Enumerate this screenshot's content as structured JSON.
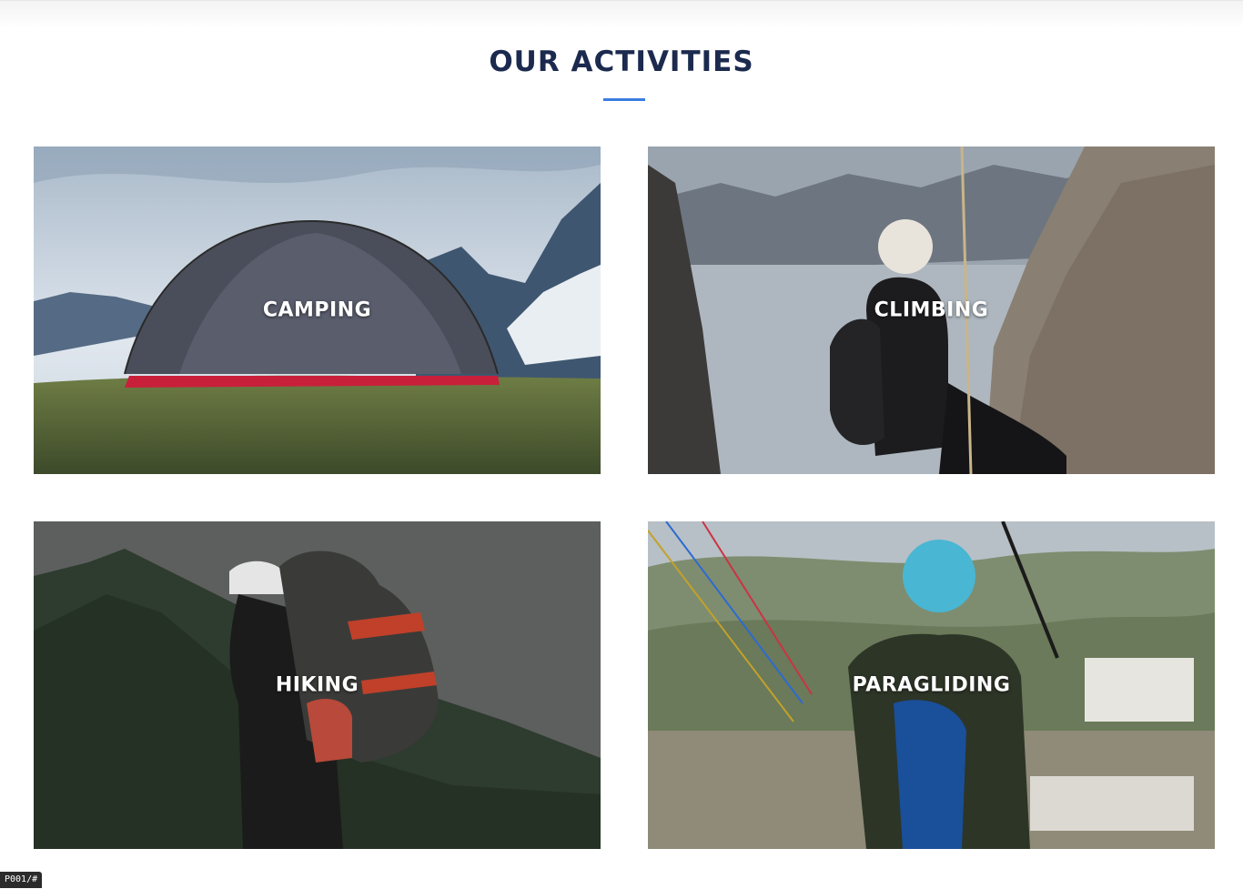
{
  "section": {
    "title": "OUR ACTIVITIES",
    "accent_color": "#3b7de0",
    "title_color": "#1b2a4e"
  },
  "activities": [
    {
      "label": "CAMPING",
      "image": "tent-on-mountain-meadow"
    },
    {
      "label": "CLIMBING",
      "image": "climber-rappelling-cliff"
    },
    {
      "label": "HIKING",
      "image": "hiker-with-backpack-forest"
    },
    {
      "label": "PARAGLIDING",
      "image": "paraglider-pilot-hills-town"
    }
  ],
  "status_bar": {
    "url": "P001/#"
  }
}
